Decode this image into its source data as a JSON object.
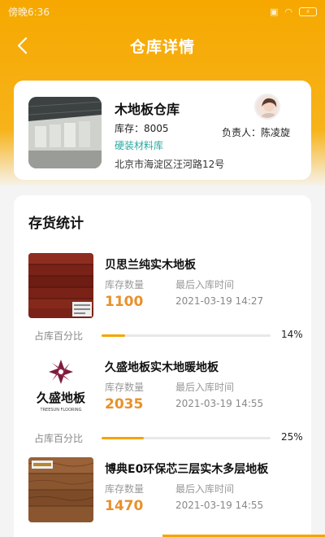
{
  "status_bar": {
    "time": "傍晚6:36",
    "battery": "⚡"
  },
  "header": {
    "title": "仓库详情"
  },
  "warehouse": {
    "name": "木地板仓库",
    "stock_label": "库存：8005",
    "category": "硬装材料库",
    "address": "北京市海淀区汪河路12号",
    "manager": "负责人：陈凌旋"
  },
  "inventory": {
    "title": "存货统计",
    "qty_label": "库存数量",
    "time_label": "最后入库时间",
    "pct_label": "占库百分比",
    "items": [
      {
        "name": "贝思兰纯实木地板",
        "qty": "1100",
        "time": "2021-03-19 14:27",
        "pct": "14%",
        "pct_value": 14
      },
      {
        "name": "久盛地板实木地暖地板",
        "qty": "2035",
        "time": "2021-03-19 14:55",
        "pct": "25%",
        "pct_value": 25,
        "logo_text": "久盛地板",
        "logo_sub": "TREESUN FLOORING"
      },
      {
        "name": "博典E0环保芯三层实木多层地板",
        "qty": "1470",
        "time": "2021-03-19 14:55"
      }
    ]
  },
  "colors": {
    "accent": "#f6a800",
    "qty": "#e8912b",
    "category": "#2aa9a0"
  }
}
